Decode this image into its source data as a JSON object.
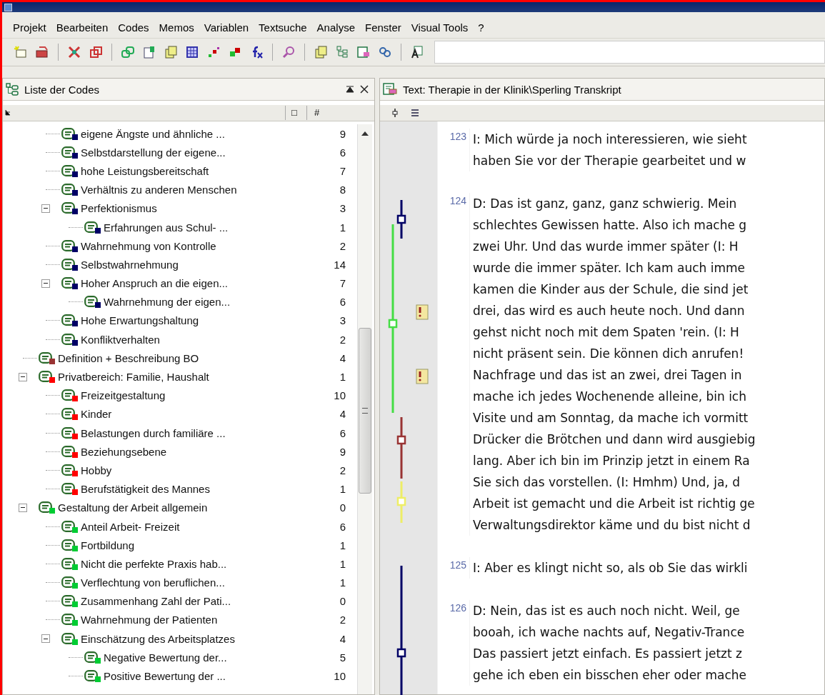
{
  "menu": [
    "Projekt",
    "Bearbeiten",
    "Codes",
    "Memos",
    "Variablen",
    "Textsuche",
    "Analyse",
    "Fenster",
    "Visual Tools",
    "?"
  ],
  "codes_panel": {
    "title": "Liste der Codes",
    "columns": [
      "□",
      "#"
    ],
    "continued": [
      {
        "label": "eigene Ängste und ähnliche ...",
        "count": "9",
        "color": "#000066"
      },
      {
        "label": "Selbstdarstellung der eigene...",
        "count": "6",
        "color": "#000066"
      },
      {
        "label": "hohe Leistungsbereitschaft",
        "count": "7",
        "color": "#000066"
      },
      {
        "label": "Verhältnis zu anderen Menschen",
        "count": "8",
        "color": "#000066"
      },
      {
        "label": "Perfektionismus",
        "count": "3",
        "color": "#000066",
        "expanded": true,
        "children": [
          {
            "label": "Erfahrungen aus Schul- ...",
            "count": "1",
            "color": "#000066"
          }
        ]
      },
      {
        "label": "Wahrnehmung von Kontrolle",
        "count": "2",
        "color": "#000066"
      },
      {
        "label": "Selbstwahrnehmung",
        "count": "14",
        "color": "#000066"
      },
      {
        "label": "Hoher Anspruch an die eigen...",
        "count": "7",
        "color": "#000066",
        "expanded": true,
        "children": [
          {
            "label": "Wahrnehmung der eigen...",
            "count": "6",
            "color": "#000066"
          }
        ]
      },
      {
        "label": "Hohe Erwartungshaltung",
        "count": "3",
        "color": "#000066"
      },
      {
        "label": "Konfliktverhalten",
        "count": "2",
        "color": "#000066"
      }
    ],
    "items": [
      {
        "label": "Definition + Beschreibung BO",
        "count": "4",
        "color": "#993333"
      },
      {
        "label": "Privatbereich: Familie, Haushalt",
        "count": "1",
        "color": "#ff0000",
        "expanded": true,
        "children": [
          {
            "label": "Freizeitgestaltung",
            "count": "10",
            "color": "#ff0000"
          },
          {
            "label": "Kinder",
            "count": "4",
            "color": "#ff0000"
          },
          {
            "label": "Belastungen durch familiäre ...",
            "count": "6",
            "color": "#ff0000"
          },
          {
            "label": "Beziehungsebene",
            "count": "9",
            "color": "#ff0000"
          },
          {
            "label": "Hobby",
            "count": "2",
            "color": "#ff0000"
          },
          {
            "label": "Berufstätigkeit des Mannes",
            "count": "1",
            "color": "#ff0000"
          }
        ]
      },
      {
        "label": "Gestaltung der Arbeit allgemein",
        "count": "0",
        "color": "#00cc33",
        "expanded": true,
        "children": [
          {
            "label": "Anteil Arbeit- Freizeit",
            "count": "6",
            "color": "#00cc33"
          },
          {
            "label": "Fortbildung",
            "count": "1",
            "color": "#00cc33"
          },
          {
            "label": "Nicht die perfekte Praxis hab...",
            "count": "1",
            "color": "#00cc33"
          },
          {
            "label": "Verflechtung von beruflichen...",
            "count": "1",
            "color": "#00cc33"
          },
          {
            "label": "Zusammenhang Zahl der Pati...",
            "count": "0",
            "color": "#00cc33"
          },
          {
            "label": "Wahrnehmung der Patienten",
            "count": "2",
            "color": "#00cc33"
          },
          {
            "label": "Einschätzung des Arbeitsplatzes",
            "count": "4",
            "color": "#00cc33",
            "expanded": true,
            "children": [
              {
                "label": "Negative Bewertung der...",
                "count": "5",
                "color": "#00cc33"
              },
              {
                "label": "Positive Bewertung  der ...",
                "count": "10",
                "color": "#00cc33"
              }
            ]
          }
        ]
      }
    ]
  },
  "text_panel": {
    "title": "Text: Therapie in der Klinik\\Sperling Transkript",
    "paragraphs": [
      {
        "number": "123",
        "lines": [
          "I: Mich würde ja noch interessieren, wie sieht",
          "haben Sie vor der Therapie gearbeitet und w"
        ]
      },
      {
        "number": "124",
        "lines": [
          "D: Das ist ganz, ganz, ganz schwierig. Mein",
          "schlechtes Gewissen hatte. Also ich mache g",
          "zwei Uhr. Und das wurde immer später (I: H",
          "wurde die immer später. Ich kam auch imme",
          "kamen die Kinder aus der Schule, die sind jet",
          "drei, das wird es auch heute noch. Und dann",
          "gehst nicht noch mit dem Spaten 'rein. (I: H",
          "nicht präsent sein. Die können dich anrufen!",
          "Nachfrage und das ist an zwei, drei Tagen in",
          "mache ich jedes Wochenende alleine, bin ich",
          "Visite und am Sonntag, da mache ich vormitt",
          "Drücker die Brötchen und dann wird ausgiebig",
          "lang. Aber ich bin im Prinzip jetzt in einem Ra",
          "Sie sich das vorstellen. (I: Hmhm) Und, ja, d",
          "Arbeit ist gemacht und die Arbeit ist richtig ge",
          "Verwaltungsdirektor käme und du bist nicht d"
        ]
      },
      {
        "number": "125",
        "lines": [
          "I: Aber es klingt nicht so, als ob Sie das wirkli"
        ]
      },
      {
        "number": "126",
        "lines": [
          "D: Nein, das ist es auch noch nicht. Weil, ge",
          "booah, ich wache nachts auf, Negativ-Trance",
          "Das passiert jetzt einfach. Es passiert jetzt z",
          "gehe ich eben ein bisschen eher oder mache"
        ]
      }
    ]
  }
}
